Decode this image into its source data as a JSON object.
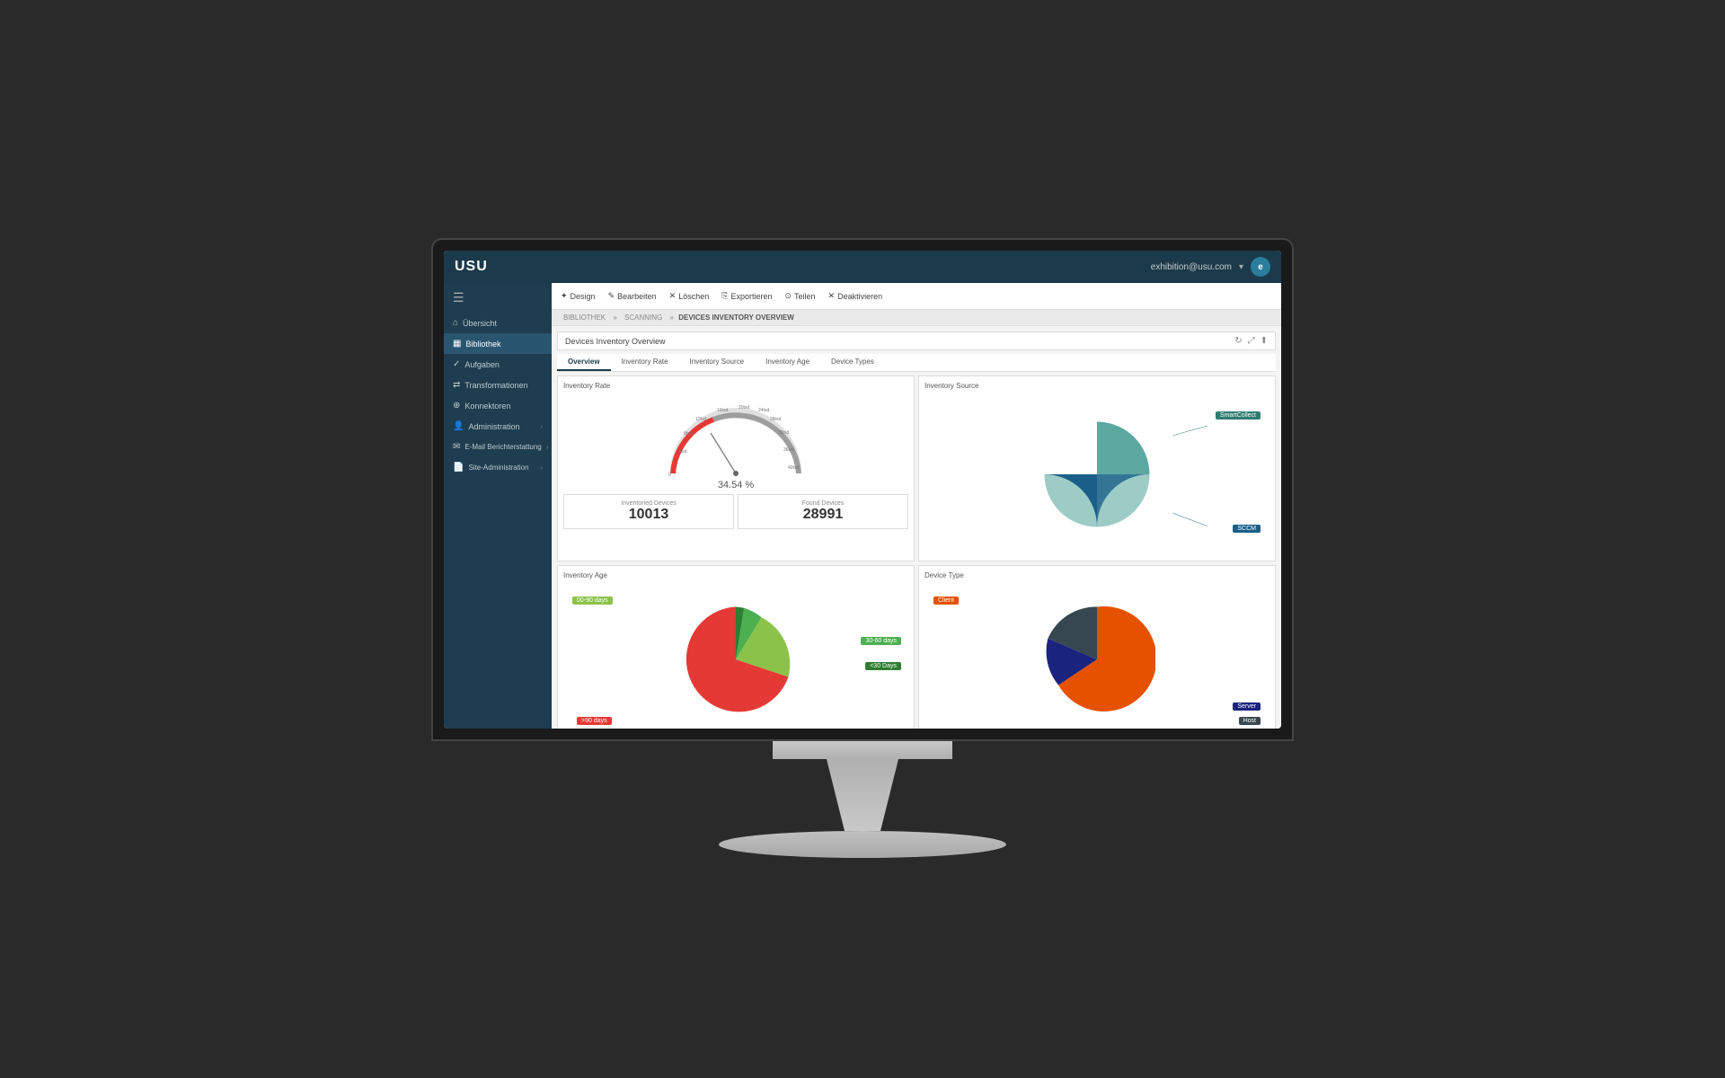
{
  "monitor": {
    "logo": "USU",
    "user_email": "exhibition@usu.com",
    "user_initial": "e"
  },
  "toolbar": {
    "buttons": [
      {
        "label": "Design",
        "icon": "✦"
      },
      {
        "label": "Bearbeiten",
        "icon": "✎"
      },
      {
        "label": "Löschen",
        "icon": "✕"
      },
      {
        "label": "Exportieren",
        "icon": "⎘"
      },
      {
        "label": "Teilen",
        "icon": "⊙"
      },
      {
        "label": "Deaktivieren",
        "icon": "✕"
      }
    ]
  },
  "breadcrumb": {
    "items": [
      "BIBLIOTHEK",
      "SCANNING",
      "DEVICES INVENTORY OVERVIEW"
    ]
  },
  "dashboard": {
    "title": "Devices Inventory Overview",
    "tabs": [
      "Overview",
      "Inventory Rate",
      "Inventory Source",
      "Inventory Age",
      "Device Types"
    ]
  },
  "inventory_rate": {
    "label": "Inventory Rate",
    "gauge_value": "34.54 %",
    "gauge_marks": [
      "0",
      "4tsd.",
      "8tsd.",
      "12tsd.",
      "16tsd.",
      "20tsd.",
      "24tsd.",
      "28tsd.",
      "32tsd.",
      "36tsd.",
      "40tsd."
    ]
  },
  "stats": {
    "inventoried_label": "Inventoried Devices",
    "inventoried_value": "10013",
    "found_label": "Found Devices",
    "found_value": "28991"
  },
  "inventory_source": {
    "label": "Inventory Source",
    "segments": [
      {
        "name": "SmartCollect",
        "color": "#5ba8a0",
        "percentage": 50
      },
      {
        "name": "SCCM",
        "color": "#1a5f8a",
        "percentage": 50
      }
    ]
  },
  "inventory_age": {
    "label": "Inventory Age",
    "segments": [
      {
        "name": "00-90 days",
        "color": "#8bc34a",
        "percentage": 15
      },
      {
        "name": "30-60 days",
        "color": "#4caf50",
        "percentage": 10
      },
      {
        "name": "<30 Days",
        "color": "#2e7d32",
        "percentage": 8
      },
      {
        "name": ">90 days",
        "color": "#e53935",
        "percentage": 67
      }
    ]
  },
  "device_type": {
    "label": "Device Type",
    "segments": [
      {
        "name": "Client",
        "color": "#e65100",
        "percentage": 75
      },
      {
        "name": "Server",
        "color": "#1a237e",
        "percentage": 15
      },
      {
        "name": "Host",
        "color": "#37474f",
        "percentage": 10
      }
    ]
  },
  "sidebar": {
    "items": [
      {
        "label": "Übersicht",
        "icon": "⌂",
        "active": false
      },
      {
        "label": "Bibliothek",
        "icon": "📚",
        "active": true
      },
      {
        "label": "Aufgaben",
        "icon": "✓",
        "active": false
      },
      {
        "label": "Transformationen",
        "icon": "⇄",
        "active": false
      },
      {
        "label": "Konnektoren",
        "icon": "⊕",
        "active": false
      },
      {
        "label": "Administration",
        "icon": "👤",
        "active": false,
        "has_arrow": true
      },
      {
        "label": "E-Mail Berichterstattung",
        "icon": "✉",
        "active": false,
        "has_arrow": true
      },
      {
        "label": "Site-Administration",
        "icon": "📄",
        "active": false,
        "has_arrow": true
      }
    ]
  }
}
